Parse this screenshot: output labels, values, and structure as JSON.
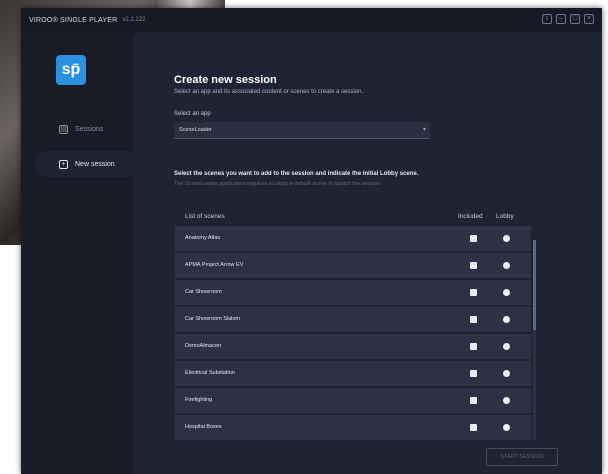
{
  "window": {
    "app_title": "VIROO® SINGLE PLAYER",
    "version": "v2.2.122",
    "controls": [
      "info",
      "minimize",
      "maximize",
      "close"
    ]
  },
  "sidebar": {
    "logo_text": "sp̄",
    "items": [
      {
        "label": "Sessions",
        "icon": "sessions-icon",
        "active": false
      },
      {
        "label": "New session",
        "icon": "add-session-icon",
        "active": true
      }
    ]
  },
  "main": {
    "title": "Create new session",
    "subtitle": "Select an app and its associated content or scenes to create a session.",
    "select_label": "Select an app",
    "select_value": "SceneLoader",
    "scenes_heading": "Select the scenes you want to add to the session and indicate the initial Lobby scene.",
    "scenes_note": "The SceneLoader application requires a Lobby  a default scene  to launch the session.",
    "list_header": {
      "name": "List of scenes",
      "included": "Included",
      "lobby": "Lobby"
    },
    "scenes": [
      "Anatomy Atlas",
      "APMA Project Arrow EV",
      "Car Showroom",
      "Car Showroom Slalom",
      "DemoAlmacen",
      "Electrical Substation",
      "Firefighting",
      "Hospital Boxes"
    ],
    "start_button": "START SESSION"
  },
  "colors": {
    "background": "#181c27",
    "panel": "#1f2432",
    "row": "#2c3243",
    "logo": "#2b8fe2",
    "scroll_thumb": "#4f6f98"
  }
}
